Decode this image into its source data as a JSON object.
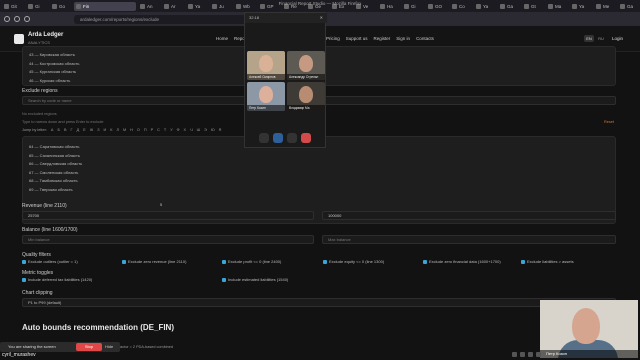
{
  "browser": {
    "window_title": "Financial Report Studio — Mozilla Firefox",
    "url": "ardaledger.com/reports/regions/exclude",
    "tabs": [
      {
        "label": "Git",
        "active": false
      },
      {
        "label": "Gi",
        "active": false
      },
      {
        "label": "Go",
        "active": false
      },
      {
        "label": "Fin",
        "active": true
      },
      {
        "label": "An",
        "active": false
      },
      {
        "label": "Ar",
        "active": false
      },
      {
        "label": "Ya",
        "active": false
      },
      {
        "label": "Ju",
        "active": false
      },
      {
        "label": "Wb",
        "active": false
      },
      {
        "label": "GP",
        "active": false
      },
      {
        "label": "Re",
        "active": false
      },
      {
        "label": "Ge",
        "active": false
      },
      {
        "label": "Ex",
        "active": false
      },
      {
        "label": "Ve",
        "active": false
      },
      {
        "label": "Ha",
        "active": false
      },
      {
        "label": "Gi",
        "active": false
      },
      {
        "label": "GO",
        "active": false
      },
      {
        "label": "Co",
        "active": false
      },
      {
        "label": "Ya",
        "active": false
      },
      {
        "label": "Ga",
        "active": false
      },
      {
        "label": "Gt",
        "active": false
      },
      {
        "label": "Ma",
        "active": false
      },
      {
        "label": "Ya",
        "active": false
      },
      {
        "label": "Me",
        "active": false
      },
      {
        "label": "Ga",
        "active": false
      }
    ]
  },
  "header": {
    "brand": "Arda Ledger",
    "brand_sub": "ANALYTICS",
    "nav_left": [
      "Home",
      "Reports"
    ],
    "nav_right": [
      "Pricing",
      "Support us",
      "Register",
      "Sign in",
      "Contacts"
    ],
    "lang_en": "EN",
    "lang_ru": "RU",
    "login": "Login"
  },
  "regions_list_top": [
    "43 — Кировская область",
    "44 — Костромская область",
    "45 — Курганская область",
    "46 — Курская область"
  ],
  "exclude": {
    "label": "Exclude regions",
    "placeholder": "Search by code or name",
    "none_note": "No excluded regions",
    "hint": "Type to narrow down and press Enter to exclude",
    "reset_label": "Reset",
    "jump_label": "Jump by letter:",
    "letters": [
      "А",
      "Б",
      "В",
      "Г",
      "Д",
      "Е",
      "Ж",
      "З",
      "И",
      "К",
      "Л",
      "М",
      "Н",
      "О",
      "П",
      "Р",
      "С",
      "Т",
      "У",
      "Ф",
      "Х",
      "Ч",
      "Ш",
      "Э",
      "Ю",
      "Я"
    ]
  },
  "regions_list_bottom": [
    "64 — Саратовская область",
    "65 — Сахалинская область",
    "66 — Свердловская область",
    "67 — Смоленская область",
    "68 — Тамбовская область",
    "69 — Тверская область"
  ],
  "revenue": {
    "label": "Revenue (line 2110)",
    "min_value": "25700",
    "max_value": "100000",
    "counter": "5"
  },
  "balance": {
    "label": "Balance (line 1600/1700)",
    "min_placeholder": "Min balance",
    "max_placeholder": "Max balance"
  },
  "quality": {
    "label": "Quality filters",
    "items": [
      "Exclude outliers (outlier = 1)",
      "Exclude zero revenue (line 2110)",
      "Exclude profit <= 0 (line 2400)",
      "Exclude equity <= 0 (line 1300)",
      "Exclude zero financial data (1600+1700)",
      "Exclude liabilities > assets"
    ]
  },
  "metric": {
    "label": "Metric toggles",
    "items": [
      "Include deferred tax liabilities (1420)",
      "Include estimated liabilities (1540)"
    ]
  },
  "clipping": {
    "label": "Chart clipping",
    "value": "P1 to P99 (default)"
  },
  "auto_bounds": {
    "title": "Auto bounds recommendation (DE_FIN)",
    "note": "Gain factor = 2 PDA-based combined"
  },
  "call": {
    "timer": "32:18",
    "participants": [
      {
        "name": "Алексей Смирнов"
      },
      {
        "name": "Александр Стрельн"
      },
      {
        "name": "Петр Козин"
      },
      {
        "name": "Владимир Ма"
      }
    ],
    "self_name": "Петр Козин"
  },
  "share": {
    "text": "You are sharing the screen",
    "stop": "Stop",
    "hide": "Hide"
  },
  "user_tag": "cyril_murashev"
}
